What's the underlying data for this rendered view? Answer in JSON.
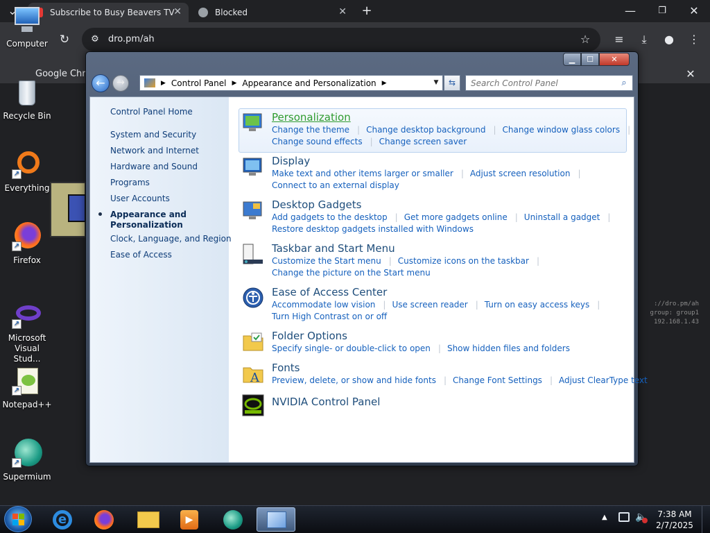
{
  "browser": {
    "tabs": [
      {
        "title": "Subscribe to Busy Beavers TV fo",
        "active": true
      },
      {
        "title": "Blocked",
        "active": false
      }
    ],
    "url": "dro.pm/ah",
    "bookmark_item": "Google Chro"
  },
  "desktop": {
    "icons": [
      {
        "label": "Computer",
        "icon": "computer-icon"
      },
      {
        "label": "Recycle Bin",
        "icon": "recycle-bin-icon"
      },
      {
        "label": "Everything",
        "icon": "everything-icon"
      },
      {
        "label": "Firefox",
        "icon": "firefox-icon"
      },
      {
        "label": "Microsoft Visual Stud...",
        "icon": "visual-studio-icon"
      },
      {
        "label": "Notepad++",
        "icon": "notepadpp-icon"
      },
      {
        "label": "Supermium",
        "icon": "supermium-icon"
      }
    ],
    "terminal_lines": [
      "://dro.pm/ah",
      "group: group1",
      "192.168.1.43"
    ]
  },
  "window": {
    "breadcrumb": [
      "Control Panel",
      "Appearance and Personalization"
    ],
    "search_placeholder": "Search Control Panel",
    "sidebar": {
      "home": "Control Panel Home",
      "items": [
        "System and Security",
        "Network and Internet",
        "Hardware and Sound",
        "Programs",
        "User Accounts",
        "Appearance and Personalization",
        "Clock, Language, and Region",
        "Ease of Access"
      ],
      "current_index": 5
    },
    "categories": [
      {
        "title": "Personalization",
        "links": [
          [
            "Change the theme",
            "Change desktop background",
            "Change window glass colors"
          ],
          [
            "Change sound effects",
            "Change screen saver"
          ]
        ]
      },
      {
        "title": "Display",
        "links": [
          [
            "Make text and other items larger or smaller",
            "Adjust screen resolution"
          ],
          [
            "Connect to an external display"
          ]
        ]
      },
      {
        "title": "Desktop Gadgets",
        "links": [
          [
            "Add gadgets to the desktop",
            "Get more gadgets online",
            "Uninstall a gadget"
          ],
          [
            "Restore desktop gadgets installed with Windows"
          ]
        ]
      },
      {
        "title": "Taskbar and Start Menu",
        "links": [
          [
            "Customize the Start menu",
            "Customize icons on the taskbar"
          ],
          [
            "Change the picture on the Start menu"
          ]
        ]
      },
      {
        "title": "Ease of Access Center",
        "links": [
          [
            "Accommodate low vision",
            "Use screen reader",
            "Turn on easy access keys"
          ],
          [
            "Turn High Contrast on or off"
          ]
        ]
      },
      {
        "title": "Folder Options",
        "links": [
          [
            "Specify single- or double-click to open",
            "Show hidden files and folders"
          ]
        ]
      },
      {
        "title": "Fonts",
        "links": [
          [
            "Preview, delete, or show and hide fonts",
            "Change Font Settings",
            "Adjust ClearType text"
          ]
        ]
      },
      {
        "title": "NVIDIA Control Panel",
        "links": []
      }
    ]
  },
  "taskbar": {
    "time": "7:38 AM",
    "date": "2/7/2025"
  }
}
